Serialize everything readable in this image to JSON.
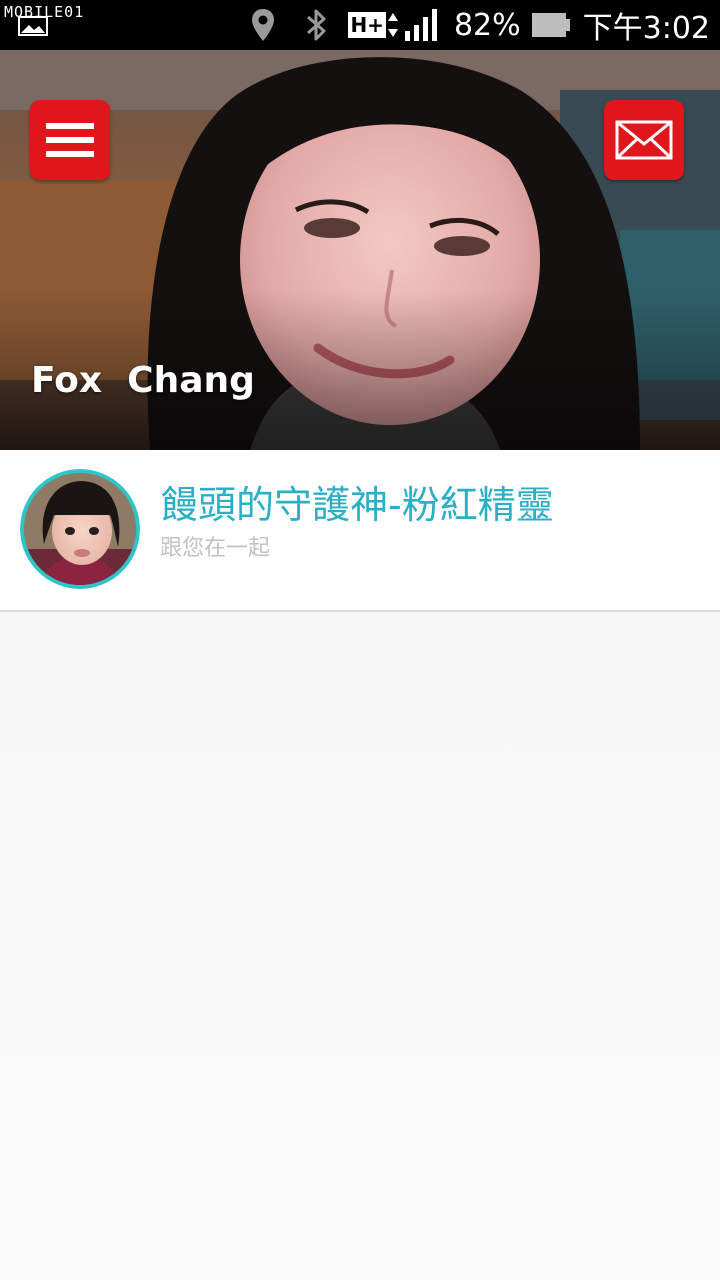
{
  "status_bar": {
    "watermark": "MOBILE01",
    "battery_percent": "82%",
    "clock": "下午3:02",
    "network_type": "H+",
    "icons": [
      "notification-picture-icon",
      "location-icon",
      "bluetooth-icon",
      "network-hplus-icon",
      "signal-icon",
      "battery-icon"
    ]
  },
  "cover": {
    "user_name": "Fox  Chang",
    "menu_icon": "hamburger-menu-icon",
    "mail_icon": "envelope-icon"
  },
  "profile": {
    "title": "饅頭的守護神-粉紅精靈",
    "subtitle": "跟您在一起"
  },
  "colors": {
    "accent_red": "#e0161b",
    "title_teal": "#2ab0c6",
    "subtitle_gray": "#c2c2c2",
    "avatar_ring": "#2cc6c9"
  }
}
